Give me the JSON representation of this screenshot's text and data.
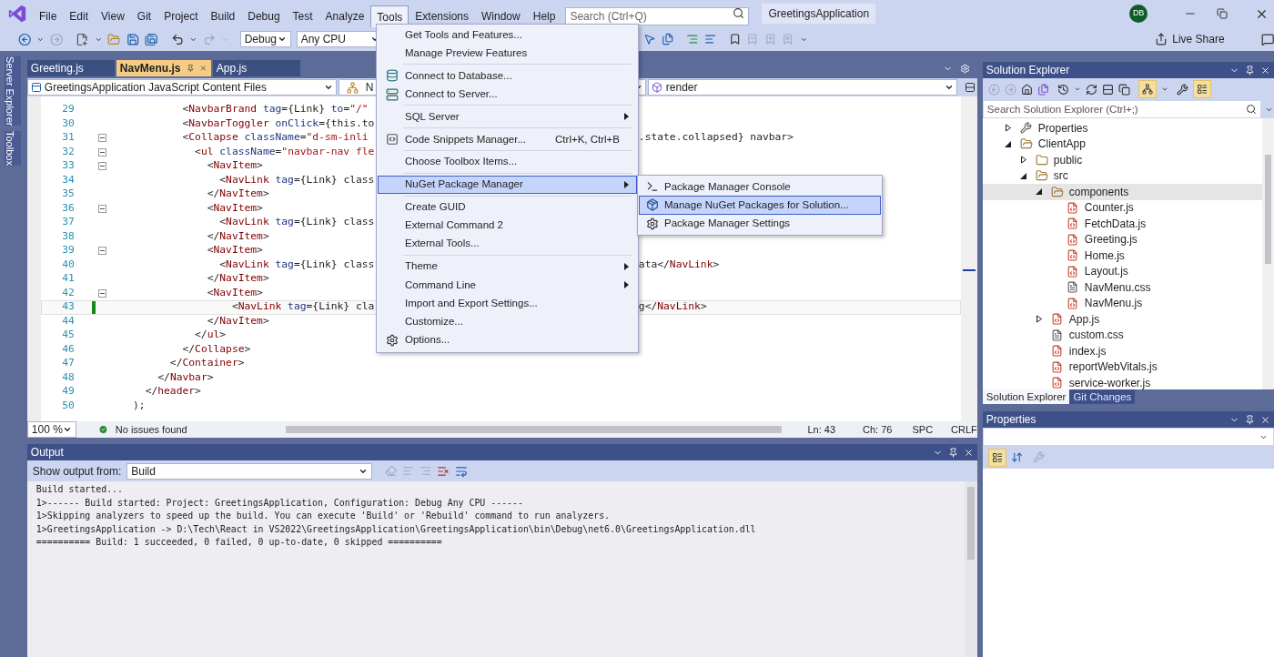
{
  "menubar": {
    "items": [
      {
        "label": "File",
        "selected": false
      },
      {
        "label": "Edit",
        "selected": false
      },
      {
        "label": "View",
        "selected": false
      },
      {
        "label": "Git",
        "selected": false
      },
      {
        "label": "Project",
        "selected": false
      },
      {
        "label": "Build",
        "selected": false
      },
      {
        "label": "Debug",
        "selected": false
      },
      {
        "label": "Test",
        "selected": false
      },
      {
        "label": "Analyze",
        "selected": false
      },
      {
        "label": "Tools",
        "selected": true
      },
      {
        "label": "Extensions",
        "selected": false
      },
      {
        "label": "Window",
        "selected": false
      },
      {
        "label": "Help",
        "selected": false
      }
    ],
    "search": {
      "placeholder": "Search (Ctrl+Q)"
    },
    "solution": "GreetingsApplication",
    "avatar": "DB"
  },
  "toolbar": {
    "configuration": "Debug",
    "platform": "Any CPU",
    "live_share": "Live Share"
  },
  "side_tabs": [
    "Server Explorer",
    "Toolbox"
  ],
  "editor": {
    "tabs": [
      {
        "label": "Greeting.js",
        "selected": false
      },
      {
        "label": "NavMenu.js",
        "selected": true
      },
      {
        "label": "App.js",
        "selected": false
      }
    ],
    "nav": {
      "project": "GreetingsApplication JavaScript Content Files",
      "type": "N",
      "member": "render"
    },
    "lines": [
      {
        "num": "29",
        "text": "            <NavbarBrand tag={Link} to=\"/\"",
        "foldable": false,
        "modified": false,
        "current": false
      },
      {
        "num": "30",
        "text": "            <NavbarToggler onClick={this.to",
        "foldable": false,
        "modified": false,
        "current": false
      },
      {
        "num": "31",
        "text": "            <Collapse className=\"d-sm-inli",
        "tail": ".state.collapsed} navbar>",
        "foldable": true,
        "modified": false,
        "current": false
      },
      {
        "num": "32",
        "text": "              <ul className=\"navbar-nav fle",
        "foldable": true,
        "modified": false,
        "current": false
      },
      {
        "num": "33",
        "text": "                <NavItem>",
        "foldable": true,
        "modified": false,
        "current": false
      },
      {
        "num": "34",
        "text": "                  <NavLink tag={Link} class",
        "foldable": false,
        "modified": false,
        "current": false
      },
      {
        "num": "35",
        "text": "                </NavItem>",
        "foldable": false,
        "modified": false,
        "current": false
      },
      {
        "num": "36",
        "text": "                <NavItem>",
        "foldable": true,
        "modified": false,
        "current": false
      },
      {
        "num": "37",
        "text": "                  <NavLink tag={Link} class",
        "foldable": false,
        "modified": false,
        "current": false
      },
      {
        "num": "38",
        "text": "                </NavItem>",
        "foldable": false,
        "modified": false,
        "current": false
      },
      {
        "num": "39",
        "text": "                <NavItem>",
        "foldable": true,
        "modified": false,
        "current": false
      },
      {
        "num": "40",
        "text": "                  <NavLink tag={Link} class",
        "tail": "ata</NavLink>",
        "foldable": false,
        "modified": false,
        "current": false
      },
      {
        "num": "41",
        "text": "                </NavItem>",
        "foldable": false,
        "modified": false,
        "current": false
      },
      {
        "num": "42",
        "text": "                <NavItem>",
        "foldable": true,
        "modified": false,
        "current": false
      },
      {
        "num": "43",
        "text": "                    <NavLink tag={Link} cla",
        "tail": "g</NavLink>",
        "foldable": false,
        "modified": true,
        "current": true
      },
      {
        "num": "44",
        "text": "                </NavItem>",
        "foldable": false,
        "modified": false,
        "current": false
      },
      {
        "num": "45",
        "text": "              </ul>",
        "foldable": false,
        "modified": false,
        "current": false
      },
      {
        "num": "46",
        "text": "            </Collapse>",
        "foldable": false,
        "modified": false,
        "current": false
      },
      {
        "num": "47",
        "text": "          </Container>",
        "foldable": false,
        "modified": false,
        "current": false
      },
      {
        "num": "48",
        "text": "        </Navbar>",
        "foldable": false,
        "modified": false,
        "current": false
      },
      {
        "num": "49",
        "text": "      </header>",
        "foldable": false,
        "modified": false,
        "current": false
      },
      {
        "num": "50",
        "text": "    );",
        "foldable": false,
        "modified": false,
        "current": false
      }
    ],
    "status": {
      "zoom": "100 %",
      "issues": "No issues found",
      "line": "Ln: 43",
      "col": "Ch: 76",
      "indent": "SPC",
      "eol": "CRLF"
    }
  },
  "output": {
    "title": "Output",
    "label": "Show output from:",
    "source": "Build",
    "lines": [
      "Build started...",
      "1>------ Build started: Project: GreetingsApplication, Configuration: Debug Any CPU ------",
      "1>Skipping analyzers to speed up the build. You can execute 'Build' or 'Rebuild' command to run analyzers.",
      "1>GreetingsApplication -> D:\\Tech\\React in VS2022\\GreetingsApplication\\GreetingsApplication\\bin\\Debug\\net6.0\\GreetingsApplication.dll",
      "========== Build: 1 succeeded, 0 failed, 0 up-to-date, 0 skipped =========="
    ]
  },
  "solution_explorer": {
    "title": "Solution Explorer",
    "search": {
      "placeholder": "Search Solution Explorer (Ctrl+;)"
    },
    "tree": [
      {
        "label": "Properties",
        "kind": "properties",
        "expanded": false,
        "selected": false
      },
      {
        "label": "ClientApp",
        "kind": "folder",
        "expanded": true,
        "selected": false,
        "children": [
          {
            "label": "public",
            "kind": "folder",
            "expanded": false,
            "selected": false
          },
          {
            "label": "src",
            "kind": "folder",
            "expanded": true,
            "selected": false,
            "children": [
              {
                "label": "components",
                "kind": "folder",
                "expanded": true,
                "selected": true,
                "children": [
                  {
                    "label": "Counter.js",
                    "kind": "js",
                    "selected": false
                  },
                  {
                    "label": "FetchData.js",
                    "kind": "js",
                    "selected": false
                  },
                  {
                    "label": "Greeting.js",
                    "kind": "js",
                    "selected": false
                  },
                  {
                    "label": "Home.js",
                    "kind": "js",
                    "selected": false
                  },
                  {
                    "label": "Layout.js",
                    "kind": "js",
                    "selected": false
                  },
                  {
                    "label": "NavMenu.css",
                    "kind": "css",
                    "selected": false
                  },
                  {
                    "label": "NavMenu.js",
                    "kind": "js",
                    "selected": false
                  }
                ]
              },
              {
                "label": "App.js",
                "kind": "js",
                "expanded": false,
                "selected": false
              },
              {
                "label": "custom.css",
                "kind": "css",
                "selected": false
              },
              {
                "label": "index.js",
                "kind": "js",
                "selected": false
              },
              {
                "label": "reportWebVitals.js",
                "kind": "js",
                "selected": false
              },
              {
                "label": "service-worker.js",
                "kind": "js",
                "selected": false
              }
            ]
          }
        ]
      }
    ],
    "tabs": [
      {
        "label": "Solution Explorer",
        "selected": true
      },
      {
        "label": "Git Changes",
        "selected": false
      }
    ]
  },
  "properties": {
    "title": "Properties"
  },
  "tools_menu": {
    "groups": [
      [
        {
          "label": "Get Tools and Features...",
          "kind": "plain",
          "submenu": false,
          "selected": false
        },
        {
          "label": "Manage Preview Features",
          "kind": "plain",
          "submenu": false,
          "selected": false
        }
      ],
      [
        {
          "label": "Connect to Database...",
          "kind": "database",
          "submenu": false,
          "selected": false
        },
        {
          "label": "Connect to Server...",
          "kind": "server",
          "submenu": false,
          "selected": false
        }
      ],
      [
        {
          "label": "SQL Server",
          "kind": "plain",
          "submenu": true,
          "selected": false
        }
      ],
      [
        {
          "label": "Code Snippets Manager...",
          "shortcut": "Ctrl+K, Ctrl+B",
          "kind": "snippet",
          "submenu": false,
          "selected": false
        }
      ],
      [
        {
          "label": "Choose Toolbox Items...",
          "kind": "plain",
          "submenu": false,
          "selected": false
        }
      ],
      [
        {
          "label": "NuGet Package Manager",
          "kind": "plain",
          "submenu": true,
          "selected": true
        }
      ],
      [
        {
          "label": "Create GUID",
          "kind": "plain",
          "submenu": false,
          "selected": false
        },
        {
          "label": "External Command 2",
          "kind": "plain",
          "submenu": false,
          "selected": false
        },
        {
          "label": "External Tools...",
          "kind": "plain",
          "submenu": false,
          "selected": false
        }
      ],
      [
        {
          "label": "Theme",
          "kind": "plain",
          "submenu": true,
          "selected": false
        },
        {
          "label": "Command Line",
          "kind": "plain",
          "submenu": true,
          "selected": false
        },
        {
          "label": "Import and Export Settings...",
          "kind": "plain",
          "submenu": false,
          "selected": false
        },
        {
          "label": "Customize...",
          "kind": "plain",
          "submenu": false,
          "selected": false
        },
        {
          "label": "Options...",
          "kind": "settings",
          "submenu": false,
          "selected": false
        }
      ]
    ]
  },
  "nuget_submenu": {
    "items": [
      {
        "label": "Package Manager Console",
        "kind": "console",
        "selected": false
      },
      {
        "label": "Manage NuGet Packages for Solution...",
        "kind": "package",
        "selected": true
      },
      {
        "label": "Package Manager Settings",
        "kind": "settings",
        "selected": false
      }
    ]
  }
}
